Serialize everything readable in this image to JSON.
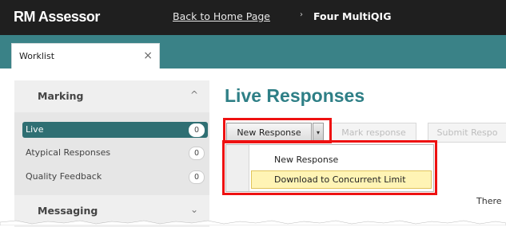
{
  "header": {
    "logo": "RM Assessor",
    "back_link": "Back to Home Page",
    "separator": "›",
    "current": "Four MultiQIG"
  },
  "tabs": [
    {
      "label": "Worklist",
      "close": "×"
    }
  ],
  "sidebar": {
    "marking": {
      "title": "Marking",
      "chevron": "^",
      "items": [
        {
          "label": "Live",
          "count": "0",
          "active": true
        },
        {
          "label": "Atypical Responses",
          "count": "0",
          "active": false
        },
        {
          "label": "Quality Feedback",
          "count": "0",
          "active": false
        }
      ]
    },
    "messaging": {
      "title": "Messaging",
      "chevron": "⌄"
    }
  },
  "main": {
    "title": "Live Responses",
    "toolbar": {
      "new_response": "New Response",
      "arrow": "▾",
      "mark_response": "Mark response",
      "submit_response": "Submit Respo"
    },
    "dropdown": {
      "items": [
        "New Response",
        "Download to Concurrent Limit"
      ],
      "hovered_index": 1
    },
    "partial_text": "There"
  },
  "colors": {
    "teal": "#3a8287",
    "title_teal": "#2e7f86",
    "active_nav": "#2f6f73",
    "highlight_red": "#ee1111"
  }
}
